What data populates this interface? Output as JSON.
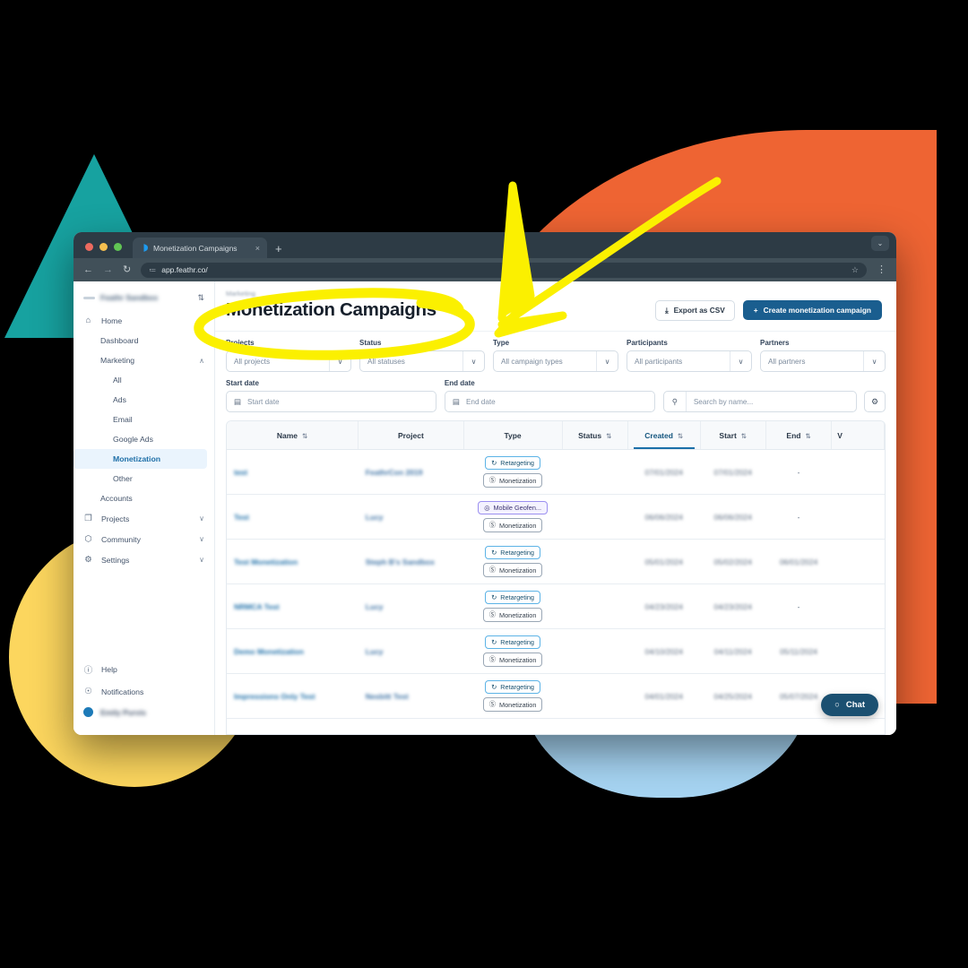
{
  "browser": {
    "tab_title": "Monetization Campaigns",
    "tab_close": "×",
    "new_tab": "+",
    "tabstrip_chevron": "⌄",
    "back": "←",
    "forward": "→",
    "reload": "↻",
    "url": "app.feathr.co/",
    "site_settings_icon": "≔",
    "bookmark_star": "☆",
    "menu_kebab": "⋮"
  },
  "sidebar": {
    "account_name": "Feathr Sandbox",
    "account_switch_icon": "⇅",
    "items": [
      {
        "label": "Home",
        "icon": "⌂",
        "chevron": "∧",
        "level": 0
      },
      {
        "label": "Dashboard",
        "level": 1
      },
      {
        "label": "Marketing",
        "chevron": "∧",
        "level": 1
      },
      {
        "label": "All",
        "level": 2
      },
      {
        "label": "Ads",
        "level": 2
      },
      {
        "label": "Email",
        "level": 2
      },
      {
        "label": "Google Ads",
        "level": 2
      },
      {
        "label": "Monetization",
        "level": 2,
        "active": true
      },
      {
        "label": "Other",
        "level": 2
      },
      {
        "label": "Accounts",
        "level": 1
      },
      {
        "label": "Projects",
        "icon": "❐",
        "chevron": "∨",
        "level": 0
      },
      {
        "label": "Community",
        "icon": "⬡",
        "chevron": "∨",
        "level": 0
      },
      {
        "label": "Settings",
        "icon": "⚙",
        "chevron": "∨",
        "level": 0
      }
    ],
    "bottom": [
      {
        "label": "Help",
        "icon": "ⓘ"
      },
      {
        "label": "Notifications",
        "icon": "☉"
      }
    ],
    "user_name": "Emily Purvis"
  },
  "page": {
    "breadcrumb": "Marketing",
    "title": "Monetization Campaigns",
    "export_label": "Export as CSV",
    "export_icon": "⤓",
    "create_label": "Create monetization campaign",
    "create_icon": "+"
  },
  "filters": {
    "projects": {
      "label": "Projects",
      "value": "All projects"
    },
    "status": {
      "label": "Status",
      "value": "All statuses"
    },
    "type": {
      "label": "Type",
      "value": "All campaign types"
    },
    "participants": {
      "label": "Participants",
      "value": "All participants"
    },
    "partners": {
      "label": "Partners",
      "value": "All partners"
    },
    "start_date": {
      "label": "Start date",
      "placeholder": "Start date",
      "icon": "Ὄ5"
    },
    "end_date": {
      "label": "End date",
      "placeholder": "End date"
    },
    "search": {
      "placeholder": "Search by name...",
      "icon": "⚲"
    },
    "settings_icon": "⚙",
    "chevron": "∨",
    "calendar_icon": "▤"
  },
  "table": {
    "columns": [
      {
        "label": "Name",
        "sort": "⇅"
      },
      {
        "label": "Project",
        "sort": ""
      },
      {
        "label": "Type",
        "sort": ""
      },
      {
        "label": "Status",
        "sort": "⇅"
      },
      {
        "label": "Created",
        "sort": "⇅",
        "active": true
      },
      {
        "label": "Start",
        "sort": "⇅"
      },
      {
        "label": "End",
        "sort": "⇅"
      },
      {
        "label": "V",
        "sort": ""
      }
    ],
    "rows": [
      {
        "name": "test",
        "project": "FeathrCon 2019",
        "chips": [
          {
            "text": "Retargeting",
            "kind": "retarget",
            "icon": "↻"
          },
          {
            "text": "Monetization",
            "kind": "mon",
            "icon": "Ⓢ"
          }
        ],
        "created": "07/01/2024",
        "start": "07/01/2024",
        "end": "-"
      },
      {
        "name": "Test",
        "project": "Lucy",
        "chips": [
          {
            "text": "Mobile Geofen...",
            "kind": "geo",
            "icon": "◎"
          },
          {
            "text": "Monetization",
            "kind": "mon",
            "icon": "Ⓢ"
          }
        ],
        "created": "06/06/2024",
        "start": "06/06/2024",
        "end": "-"
      },
      {
        "name": "Test Monetization",
        "project": "Steph B's Sandbox",
        "chips": [
          {
            "text": "Retargeting",
            "kind": "retarget",
            "icon": "↻"
          },
          {
            "text": "Monetization",
            "kind": "mon",
            "icon": "Ⓢ"
          }
        ],
        "created": "05/01/2024",
        "start": "05/02/2024",
        "end": "06/01/2024"
      },
      {
        "name": "NRMCA Test",
        "project": "Lucy",
        "chips": [
          {
            "text": "Retargeting",
            "kind": "retarget",
            "icon": "↻"
          },
          {
            "text": "Monetization",
            "kind": "mon",
            "icon": "Ⓢ"
          }
        ],
        "created": "04/23/2024",
        "start": "04/23/2024",
        "end": "-"
      },
      {
        "name": "Demo Monetization",
        "project": "Lucy",
        "chips": [
          {
            "text": "Retargeting",
            "kind": "retarget",
            "icon": "↻"
          },
          {
            "text": "Monetization",
            "kind": "mon",
            "icon": "Ⓢ"
          }
        ],
        "created": "04/10/2024",
        "start": "04/11/2024",
        "end": "05/11/2024"
      },
      {
        "name": "Impressions Only Test",
        "project": "Nesbitt Test",
        "chips": [
          {
            "text": "Retargeting",
            "kind": "retarget",
            "icon": "↻"
          },
          {
            "text": "Monetization",
            "kind": "mon",
            "icon": "Ⓢ"
          }
        ],
        "created": "04/01/2024",
        "start": "04/25/2024",
        "end": "05/07/2024"
      }
    ]
  },
  "chat": {
    "label": "Chat",
    "icon": "○"
  },
  "colors": {
    "orange": "#ee6433",
    "teal": "#17a2a0",
    "yellow_shape": "#fcd65e",
    "blue_shape": "#a6d4f2",
    "annotation_yellow": "#fbf000",
    "primary_button": "#1a5e8f",
    "link_blue": "#1e6fa8",
    "chat_bg": "#1b5071"
  }
}
